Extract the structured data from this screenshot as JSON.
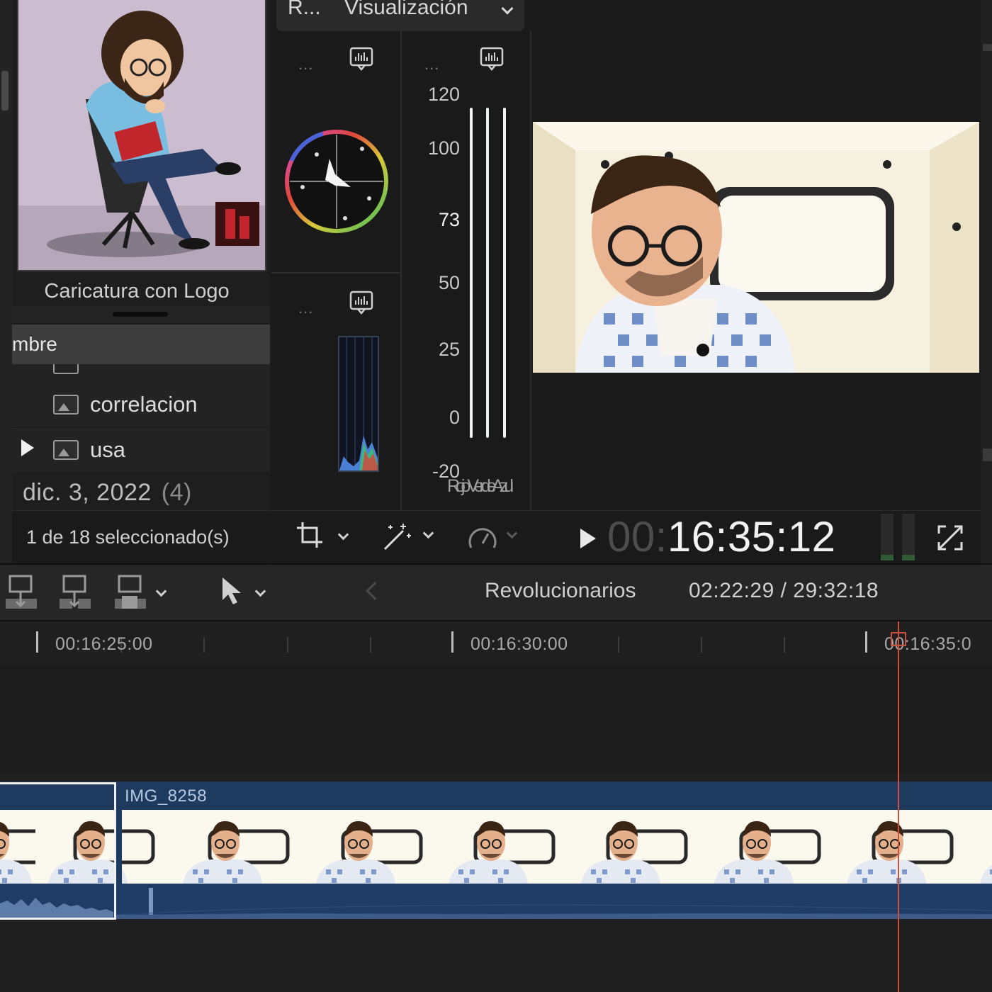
{
  "browser": {
    "thumbnail_label": "Caricatura con Logo",
    "column_header": "mbre",
    "rows": [
      {
        "label": "correlacion",
        "has_disclosure": false
      },
      {
        "label": "usa",
        "has_disclosure": true
      }
    ],
    "date_group": "dic. 3, 2022",
    "date_count": "(4)",
    "footer_status": "1 de 18 seleccionado(s)"
  },
  "scopes": {
    "tab_left": "R...",
    "tab_view": "Visualización",
    "options_dots": "...",
    "waveform_ticks": [
      "120",
      "100",
      "73",
      "50",
      "25",
      "0",
      "-20"
    ],
    "rgb_labels": "Rojo Verde Azul"
  },
  "viewer": {
    "timecode_dim": "00:",
    "timecode": "16:35:12"
  },
  "timeline": {
    "project_name": "Revolucionarios",
    "position": "02:22:29 / 29:32:18",
    "ruler_labels": [
      "00:16:25:00",
      "00:16:30:00",
      "00:16:35:0"
    ],
    "clip_name": "IMG_8258"
  },
  "icons": {
    "append": "append-clip-icon",
    "insert": "insert-clip-icon",
    "overwrite": "overwrite-clip-icon",
    "select_tool": "arrow-tool-icon",
    "crop": "crop-icon",
    "magic": "magic-wand-icon",
    "speed": "speedometer-icon",
    "fullscreen": "fullscreen-icon",
    "scope_settings": "scope-settings-icon"
  },
  "colors": {
    "clip_blue": "#1e3a5f",
    "audio_blue": "#1f3c66",
    "playhead": "#c9513d"
  }
}
